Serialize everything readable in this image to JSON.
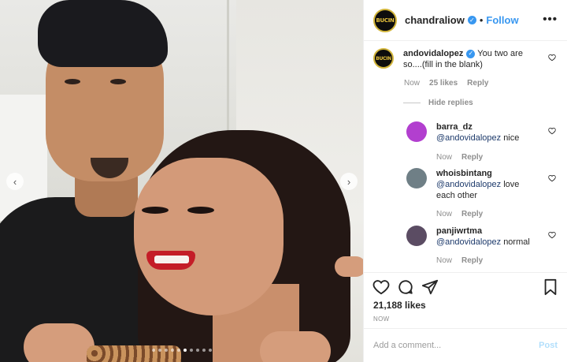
{
  "header": {
    "avatar_logo_text": "BUCIN",
    "username": "chandraliow",
    "separator": "•",
    "follow_label": "Follow",
    "more_label": "•••"
  },
  "carousel": {
    "prev_label": "‹",
    "next_label": "›",
    "slide_count": 10,
    "active_slide": 6
  },
  "main_comment": {
    "avatar_logo_text": "BUCIN",
    "username": "andovidalopez",
    "text": "You two are so....(fill in the blank)",
    "time": "Now",
    "likes": "25 likes",
    "reply_label": "Reply"
  },
  "hide_replies_label": "Hide replies",
  "replies": [
    {
      "username": "barra_dz",
      "mention": "@andovidalopez",
      "text": "nice",
      "time": "Now",
      "reply_label": "Reply",
      "avatar_color": "#b23fcf"
    },
    {
      "username": "whoisbintang",
      "mention": "@andovidalopez",
      "text": "love each other",
      "time": "Now",
      "reply_label": "Reply",
      "avatar_color": "#6f7f86"
    },
    {
      "username": "panjiwrtma",
      "mention": "@andovidalopez",
      "text": "normal",
      "time": "Now",
      "reply_label": "Reply",
      "avatar_color": "#5b4c63"
    }
  ],
  "actions": {
    "icons": [
      "heart-icon",
      "comment-icon",
      "share-icon",
      "bookmark-icon"
    ],
    "likes_text": "21,188 likes",
    "time_text": "NOW"
  },
  "add_comment": {
    "placeholder": "Add a comment...",
    "post_label": "Post"
  },
  "colors": {
    "accent": "#3897f0",
    "mention": "#1d3a6b",
    "muted": "#8e8e8e",
    "logo_gold": "#e8c33c"
  }
}
